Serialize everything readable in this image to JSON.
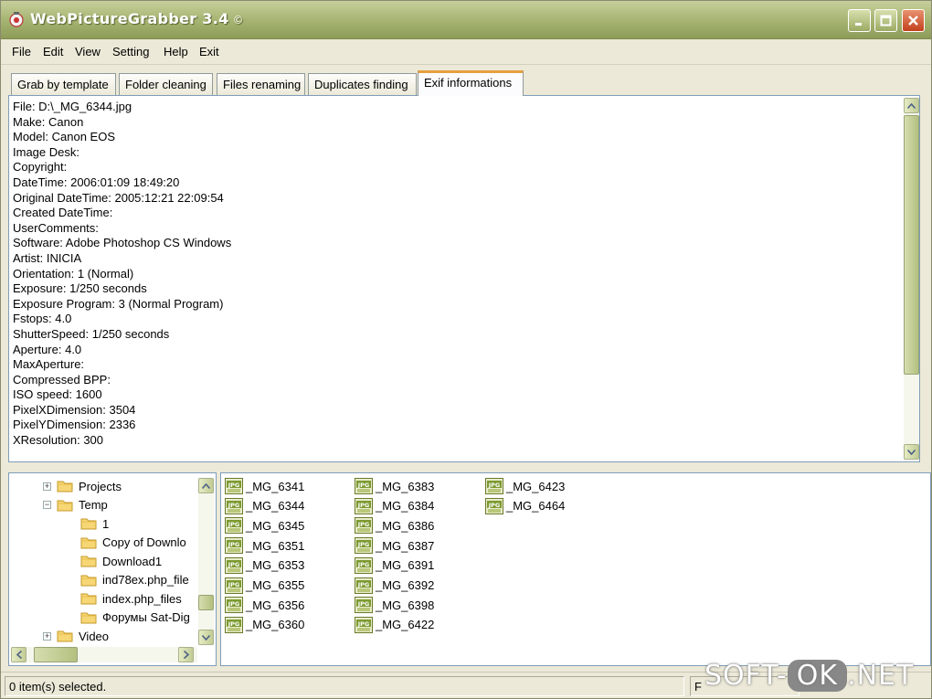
{
  "window": {
    "title": "WebPictureGrabber 3.4",
    "title_suffix": "©"
  },
  "menu": [
    "File",
    "Edit",
    "View",
    "Setting",
    "Help",
    "Exit"
  ],
  "tabs": [
    {
      "label": "Grab by template",
      "active": false
    },
    {
      "label": "Folder cleaning",
      "active": false
    },
    {
      "label": "Files renaming",
      "active": false
    },
    {
      "label": "Duplicates finding",
      "active": false
    },
    {
      "label": "Exif informations",
      "active": true
    }
  ],
  "exif": [
    "File: D:\\_MG_6344.jpg",
    "Make: Canon",
    "Model: Canon EOS",
    "Image Desk:",
    "Copyright:",
    "DateTime: 2006:01:09 18:49:20",
    "Original DateTime: 2005:12:21 22:09:54",
    "Created DateTime:",
    "UserComments:",
    "Software: Adobe Photoshop CS Windows",
    "Artist: INICIA",
    "Orientation: 1 (Normal)",
    "Exposure: 1/250 seconds",
    "Exposure Program: 3 (Normal Program)",
    "Fstops: 4.0",
    "ShutterSpeed: 1/250 seconds",
    "Aperture: 4.0",
    "MaxAperture:",
    "Compressed BPP:",
    "ISO speed: 1600",
    "PixelXDimension: 3504",
    "PixelYDimension: 2336",
    "XResolution: 300"
  ],
  "tree": [
    {
      "label": "Projects",
      "toggle": "+",
      "depth": 0
    },
    {
      "label": "Temp",
      "toggle": "−",
      "depth": 0
    },
    {
      "label": "1",
      "toggle": "",
      "depth": 1
    },
    {
      "label": "Copy of Downlo",
      "toggle": "",
      "depth": 1
    },
    {
      "label": "Download1",
      "toggle": "",
      "depth": 1
    },
    {
      "label": "ind78ex.php_file",
      "toggle": "",
      "depth": 1
    },
    {
      "label": "index.php_files",
      "toggle": "",
      "depth": 1
    },
    {
      "label": "Форумы Sat-Dig",
      "toggle": "",
      "depth": 1
    },
    {
      "label": "Video",
      "toggle": "+",
      "depth": 0
    }
  ],
  "files": {
    "icon_label": "JPG",
    "columns": [
      [
        "_MG_6341",
        "_MG_6344",
        "_MG_6345",
        "_MG_6351",
        "_MG_6353",
        "_MG_6355",
        "_MG_6356",
        "_MG_6360"
      ],
      [
        "_MG_6383",
        "_MG_6384",
        "_MG_6386",
        "_MG_6387",
        "_MG_6391",
        "_MG_6392",
        "_MG_6398",
        "_MG_6422"
      ],
      [
        "_MG_6423",
        "_MG_6464"
      ]
    ]
  },
  "status": {
    "selected": "0 item(s) selected.",
    "right": "F"
  },
  "watermark": {
    "left": "SOFT-",
    "ok": "OK",
    "right": ".NET"
  },
  "colors": {
    "titlebar": "#aab877",
    "active_tab_accent": "#e6a040",
    "scrollbar_thumb": "#b3c07f"
  }
}
